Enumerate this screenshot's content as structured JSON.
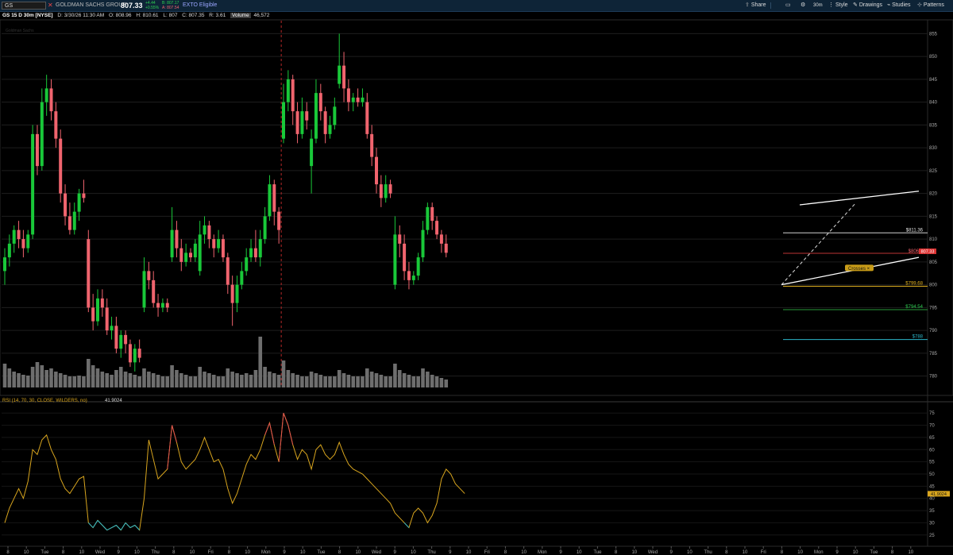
{
  "toolbar": {
    "symbol": "GS",
    "company": "GOLDMAN SACHS GROUP",
    "last": "807.33",
    "change": "+4.44",
    "change_pct": "+0.55%",
    "bid": "B: 807.17",
    "ask": "A: 807.54",
    "exto": "EXTO Eligible",
    "share": "Share",
    "interval": "30m",
    "style": "Style",
    "drawings": "Drawings",
    "studies": "Studies",
    "patterns": "Patterns"
  },
  "infobar": {
    "title": "GS 15 D 30m [NYSE]",
    "date": "D: 3/30/26 11:30 AM",
    "open": "O: 808.96",
    "high": "H: 810.61",
    "low": "L: 807",
    "close": "C: 807.35",
    "range": "R: 3.61",
    "volume_label": "Volume",
    "volume": "46,572"
  },
  "watermark": "Goldman Sachs",
  "rsi": {
    "label": "RSI (14, 70, 30, CLOSE, WILDERS, no)",
    "value": "41.9024"
  },
  "price_labels": {
    "last": "807.33",
    "res": "$811.36",
    "red": "$806.9",
    "orange": "$799.68",
    "green": "$794.54",
    "cyan": "$788",
    "crosses": "Crosses"
  },
  "colors": {
    "up": "#19c839",
    "down": "#f0646e",
    "volume": "#6e6e6e",
    "rsi": "#d8a51e",
    "grid": "#1e1e1e",
    "divider": "#b42828"
  },
  "chart_data": {
    "type": "candlestick",
    "price_axis_ticks": [
      780,
      785,
      790,
      795,
      800,
      805,
      810,
      815,
      820,
      825,
      830,
      835,
      840,
      845,
      850,
      855
    ],
    "rsi_axis_ticks": [
      25,
      30,
      35,
      40,
      45,
      50,
      55,
      60,
      65,
      70,
      75
    ],
    "time_axis_labels": [
      "8",
      "10",
      "Tue",
      "8",
      "10",
      "Wed",
      "9",
      "10",
      "Thu",
      "8",
      "10",
      "Fri",
      "8",
      "10",
      "Mon",
      "9",
      "10",
      "Tue",
      "8",
      "10",
      "Wed",
      "9",
      "10",
      "Thu",
      "9",
      "10",
      "Fri",
      "8",
      "10",
      "Mon",
      "9",
      "10",
      "Tue",
      "8",
      "10",
      "Wed",
      "9",
      "10",
      "Thu",
      "8",
      "10",
      "Fri",
      "8",
      "10",
      "Mon",
      "9",
      "10",
      "Tue",
      "8",
      "10"
    ],
    "candles": [
      {
        "o": 803,
        "c": 806,
        "h": 808,
        "l": 800
      },
      {
        "o": 806,
        "c": 809,
        "h": 811,
        "l": 804
      },
      {
        "o": 809,
        "c": 812,
        "h": 813,
        "l": 807
      },
      {
        "o": 812,
        "c": 810,
        "h": 814,
        "l": 808
      },
      {
        "o": 810,
        "c": 808,
        "h": 812,
        "l": 806
      },
      {
        "o": 808,
        "c": 811,
        "h": 812,
        "l": 807
      },
      {
        "o": 811,
        "c": 833,
        "h": 835,
        "l": 810
      },
      {
        "o": 833,
        "c": 826,
        "h": 835,
        "l": 824
      },
      {
        "o": 826,
        "c": 840,
        "h": 843,
        "l": 825
      },
      {
        "o": 840,
        "c": 843,
        "h": 846,
        "l": 837
      },
      {
        "o": 843,
        "c": 838,
        "h": 845,
        "l": 836
      },
      {
        "o": 838,
        "c": 832,
        "h": 840,
        "l": 830
      },
      {
        "o": 832,
        "c": 820,
        "h": 834,
        "l": 818
      },
      {
        "o": 820,
        "c": 815,
        "h": 822,
        "l": 813
      },
      {
        "o": 815,
        "c": 812,
        "h": 818,
        "l": 811
      },
      {
        "o": 812,
        "c": 816,
        "h": 818,
        "l": 811
      },
      {
        "o": 816,
        "c": 820,
        "h": 821,
        "l": 814
      },
      {
        "o": 820,
        "c": 819,
        "h": 823,
        "l": 818
      },
      {
        "o": 810,
        "c": 795,
        "h": 812,
        "l": 794
      },
      {
        "o": 795,
        "c": 792,
        "h": 798,
        "l": 790
      },
      {
        "o": 792,
        "c": 797,
        "h": 799,
        "l": 791
      },
      {
        "o": 797,
        "c": 795,
        "h": 799,
        "l": 793
      },
      {
        "o": 795,
        "c": 790,
        "h": 797,
        "l": 789
      },
      {
        "o": 790,
        "c": 791,
        "h": 793,
        "l": 788
      },
      {
        "o": 791,
        "c": 786,
        "h": 793,
        "l": 785
      },
      {
        "o": 786,
        "c": 789,
        "h": 790,
        "l": 784
      },
      {
        "o": 789,
        "c": 787,
        "h": 790,
        "l": 785
      },
      {
        "o": 787,
        "c": 783,
        "h": 788,
        "l": 782
      },
      {
        "o": 783,
        "c": 786,
        "h": 787,
        "l": 781
      },
      {
        "o": 786,
        "c": 784,
        "h": 788,
        "l": 783
      },
      {
        "o": 795,
        "c": 803,
        "h": 806,
        "l": 794
      },
      {
        "o": 803,
        "c": 801,
        "h": 805,
        "l": 799
      },
      {
        "o": 801,
        "c": 796,
        "h": 803,
        "l": 795
      },
      {
        "o": 796,
        "c": 795,
        "h": 798,
        "l": 793
      },
      {
        "o": 795,
        "c": 796,
        "h": 797,
        "l": 794
      },
      {
        "o": 796,
        "c": 795,
        "h": 797,
        "l": 794
      },
      {
        "o": 806,
        "c": 812,
        "h": 817,
        "l": 805
      },
      {
        "o": 812,
        "c": 808,
        "h": 814,
        "l": 806
      },
      {
        "o": 808,
        "c": 805,
        "h": 810,
        "l": 803
      },
      {
        "o": 805,
        "c": 807,
        "h": 809,
        "l": 804
      },
      {
        "o": 807,
        "c": 806,
        "h": 808,
        "l": 805
      },
      {
        "o": 806,
        "c": 809,
        "h": 810,
        "l": 805
      },
      {
        "o": 803,
        "c": 811,
        "h": 814,
        "l": 802
      },
      {
        "o": 811,
        "c": 813,
        "h": 815,
        "l": 809
      },
      {
        "o": 813,
        "c": 810,
        "h": 814,
        "l": 808
      },
      {
        "o": 810,
        "c": 808,
        "h": 811,
        "l": 806
      },
      {
        "o": 808,
        "c": 810,
        "h": 812,
        "l": 807
      },
      {
        "o": 810,
        "c": 806,
        "h": 811,
        "l": 805
      },
      {
        "o": 806,
        "c": 800,
        "h": 807,
        "l": 798
      },
      {
        "o": 800,
        "c": 796,
        "h": 802,
        "l": 791
      },
      {
        "o": 796,
        "c": 800,
        "h": 802,
        "l": 794
      },
      {
        "o": 800,
        "c": 803,
        "h": 805,
        "l": 799
      },
      {
        "o": 803,
        "c": 806,
        "h": 808,
        "l": 802
      },
      {
        "o": 806,
        "c": 808,
        "h": 810,
        "l": 805
      },
      {
        "o": 808,
        "c": 806,
        "h": 812,
        "l": 805
      },
      {
        "o": 806,
        "c": 810,
        "h": 812,
        "l": 804
      },
      {
        "o": 810,
        "c": 815,
        "h": 817,
        "l": 809
      },
      {
        "o": 815,
        "c": 822,
        "h": 824,
        "l": 814
      },
      {
        "o": 822,
        "c": 816,
        "h": 823,
        "l": 813
      },
      {
        "o": 816,
        "c": 812,
        "h": 817,
        "l": 809
      },
      {
        "o": 832,
        "c": 840,
        "h": 844,
        "l": 831
      },
      {
        "o": 840,
        "c": 845,
        "h": 847,
        "l": 838
      },
      {
        "o": 845,
        "c": 838,
        "h": 846,
        "l": 835
      },
      {
        "o": 838,
        "c": 833,
        "h": 840,
        "l": 831
      },
      {
        "o": 833,
        "c": 838,
        "h": 841,
        "l": 832
      },
      {
        "o": 838,
        "c": 836,
        "h": 840,
        "l": 834
      },
      {
        "o": 826,
        "c": 832,
        "h": 834,
        "l": 820
      },
      {
        "o": 832,
        "c": 842,
        "h": 845,
        "l": 831
      },
      {
        "o": 842,
        "c": 838,
        "h": 844,
        "l": 836
      },
      {
        "o": 838,
        "c": 833,
        "h": 839,
        "l": 831
      },
      {
        "o": 833,
        "c": 835,
        "h": 837,
        "l": 832
      },
      {
        "o": 835,
        "c": 839,
        "h": 841,
        "l": 834
      },
      {
        "o": 844,
        "c": 848,
        "h": 855,
        "l": 843
      },
      {
        "o": 848,
        "c": 843,
        "h": 851,
        "l": 840
      },
      {
        "o": 843,
        "c": 840,
        "h": 845,
        "l": 838
      },
      {
        "o": 840,
        "c": 841,
        "h": 842,
        "l": 838
      },
      {
        "o": 841,
        "c": 840,
        "h": 843,
        "l": 839
      },
      {
        "o": 840,
        "c": 841,
        "h": 843,
        "l": 839
      },
      {
        "o": 840,
        "c": 833,
        "h": 842,
        "l": 832
      },
      {
        "o": 833,
        "c": 828,
        "h": 835,
        "l": 826
      },
      {
        "o": 828,
        "c": 822,
        "h": 830,
        "l": 820
      },
      {
        "o": 822,
        "c": 819,
        "h": 824,
        "l": 817
      },
      {
        "o": 819,
        "c": 822,
        "h": 824,
        "l": 818
      },
      {
        "o": 822,
        "c": 820,
        "h": 823,
        "l": 819
      },
      {
        "o": 800,
        "c": 811,
        "h": 815,
        "l": 799
      },
      {
        "o": 811,
        "c": 809,
        "h": 813,
        "l": 806
      },
      {
        "o": 809,
        "c": 803,
        "h": 811,
        "l": 801
      },
      {
        "o": 803,
        "c": 801,
        "h": 805,
        "l": 799
      },
      {
        "o": 801,
        "c": 802,
        "h": 803,
        "l": 800
      },
      {
        "o": 802,
        "c": 806,
        "h": 807,
        "l": 801
      },
      {
        "o": 806,
        "c": 812,
        "h": 814,
        "l": 805
      },
      {
        "o": 812,
        "c": 817,
        "h": 818,
        "l": 811
      },
      {
        "o": 817,
        "c": 814,
        "h": 818,
        "l": 812
      },
      {
        "o": 814,
        "c": 811,
        "h": 815,
        "l": 810
      },
      {
        "o": 811,
        "c": 809,
        "h": 812,
        "l": 807
      },
      {
        "o": 809,
        "c": 807,
        "h": 811,
        "l": 806
      }
    ],
    "volume": [
      30,
      24,
      20,
      18,
      16,
      15,
      26,
      32,
      28,
      22,
      24,
      20,
      18,
      16,
      14,
      14,
      15,
      14,
      36,
      28,
      24,
      20,
      18,
      16,
      22,
      26,
      20,
      18,
      16,
      14,
      24,
      20,
      18,
      16,
      14,
      14,
      28,
      22,
      18,
      16,
      14,
      14,
      26,
      20,
      18,
      16,
      14,
      14,
      24,
      20,
      18,
      16,
      18,
      16,
      22,
      64,
      26,
      20,
      18,
      16,
      34,
      22,
      18,
      16,
      14,
      14,
      20,
      18,
      16,
      14,
      14,
      14,
      22,
      18,
      16,
      14,
      14,
      14,
      24,
      20,
      18,
      16,
      14,
      14,
      30,
      22,
      18,
      16,
      14,
      14,
      24,
      20,
      16,
      14,
      12,
      10
    ],
    "rsi": [
      30,
      36,
      40,
      44,
      40,
      47,
      60,
      58,
      64,
      66,
      60,
      56,
      48,
      44,
      42,
      45,
      48,
      49,
      30,
      28,
      31,
      29,
      27,
      28,
      29,
      27,
      30,
      28,
      29,
      27,
      40,
      64,
      56,
      48,
      50,
      52,
      70,
      63,
      55,
      52,
      54,
      56,
      60,
      65,
      60,
      55,
      56,
      52,
      44,
      38,
      42,
      48,
      54,
      58,
      56,
      60,
      66,
      71,
      62,
      55,
      75,
      70,
      62,
      56,
      60,
      58,
      52,
      60,
      62,
      58,
      56,
      58,
      63,
      58,
      54,
      52,
      51,
      50,
      48,
      46,
      44,
      42,
      40,
      38,
      34,
      32,
      30,
      28,
      34,
      36,
      34,
      30,
      33,
      38,
      48,
      52,
      50,
      46,
      44,
      42
    ]
  }
}
